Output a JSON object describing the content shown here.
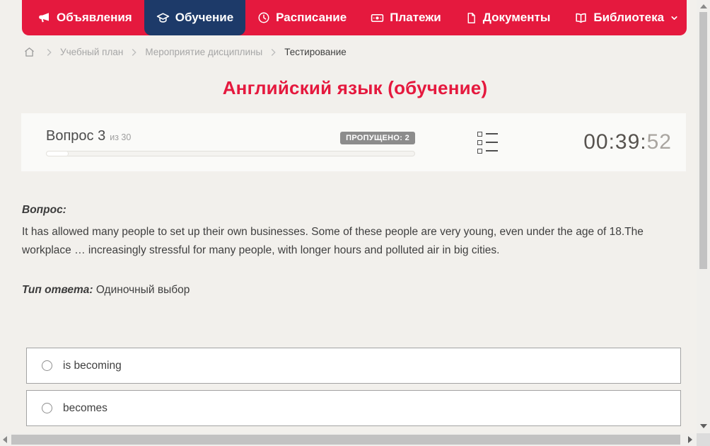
{
  "nav": {
    "items": [
      {
        "label": "Объявления",
        "icon": "megaphone-icon",
        "active": false
      },
      {
        "label": "Обучение",
        "icon": "graduation-cap-icon",
        "active": true
      },
      {
        "label": "Расписание",
        "icon": "clock-icon",
        "active": false
      },
      {
        "label": "Платежи",
        "icon": "banknote-icon",
        "active": false
      },
      {
        "label": "Документы",
        "icon": "document-icon",
        "active": false
      },
      {
        "label": "Библиотека",
        "icon": "open-book-icon",
        "active": false,
        "has_dropdown": true
      }
    ]
  },
  "breadcrumb": {
    "home_icon": "home-icon",
    "items": [
      {
        "label": "Учебный план",
        "current": false
      },
      {
        "label": "Мероприятие дисциплины",
        "current": false
      },
      {
        "label": "Тестирование",
        "current": true
      }
    ]
  },
  "page": {
    "title": "Английский язык (обучение)"
  },
  "question_header": {
    "question_label": "Вопрос 3",
    "question_of": "из 30",
    "skipped_badge": "ПРОПУЩЕНО: 2",
    "progress_percent": 6,
    "list_icon": "question-list-icon",
    "timer_main": "00:39:",
    "timer_seconds": "52"
  },
  "question": {
    "label": "Вопрос:",
    "text": "It has allowed many people to set up their own businesses. Some of these people are very young, even under the age of 18.The workplace … increasingly stressful for many people, with longer hours and polluted air in big cities.",
    "answer_type_label": "Тип ответа:",
    "answer_type_value": "Одиночный выбор"
  },
  "options": [
    {
      "label": "is becoming",
      "selected": false
    },
    {
      "label": "becomes",
      "selected": false
    }
  ],
  "colors": {
    "accent_red": "#e5193e",
    "active_tab_navy": "#1d3a69",
    "page_background": "#f2f0ec",
    "card_background": "#fafaf8",
    "badge_gray": "#8c8c8c",
    "scroll_thumb": "#c2c2c2"
  }
}
